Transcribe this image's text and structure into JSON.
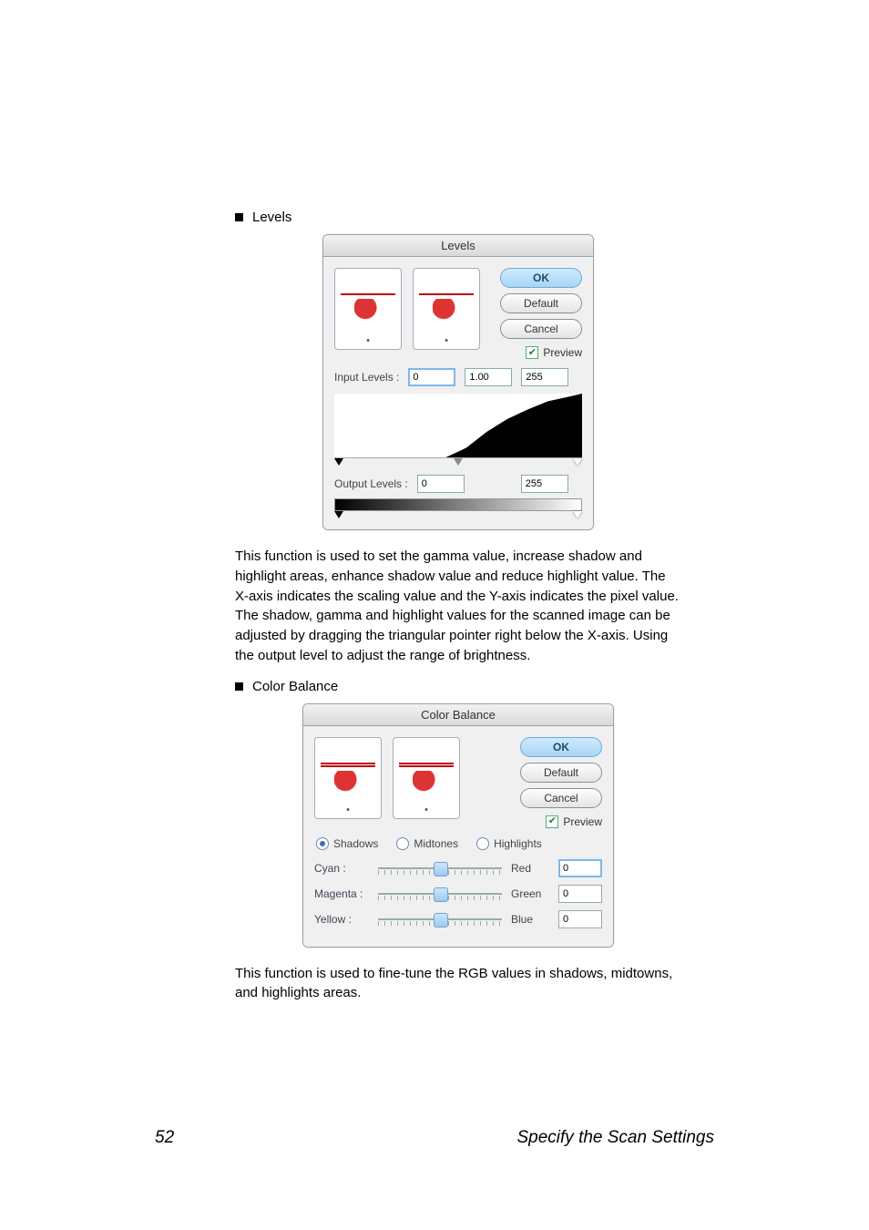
{
  "bullets": {
    "levels": "Levels",
    "color_balance": "Color Balance"
  },
  "levels_dialog": {
    "title": "Levels",
    "buttons": {
      "ok": "OK",
      "default": "Default",
      "cancel": "Cancel"
    },
    "preview": "Preview",
    "input_label": "Input Levels :",
    "input_vals": {
      "a": "0",
      "b": "1.00",
      "c": "255"
    },
    "output_label": "Output Levels :",
    "output_vals": {
      "a": "0",
      "b": "255"
    }
  },
  "levels_para": "This function is used to set the gamma value, increase shadow and highlight areas, enhance shadow value and reduce highlight value. The X-axis indicates the scaling value and the Y-axis indicates the pixel value. The shadow, gamma and highlight values for the scanned image can be adjusted by dragging the triangular pointer right below the X-axis. Using the output level to adjust the range of brightness.",
  "cb_dialog": {
    "title": "Color Balance",
    "buttons": {
      "ok": "OK",
      "default": "Default",
      "cancel": "Cancel"
    },
    "preview": "Preview",
    "radios": {
      "shadows": "Shadows",
      "midtones": "Midtones",
      "highlights": "Highlights"
    },
    "rows": {
      "cyan": {
        "left": "Cyan :",
        "right": "Red",
        "val": "0"
      },
      "magenta": {
        "left": "Magenta :",
        "right": "Green",
        "val": "0"
      },
      "yellow": {
        "left": "Yellow :",
        "right": "Blue",
        "val": "0"
      }
    }
  },
  "cb_para": "This function is used to fine-tune the RGB values in shadows, midtowns, and highlights areas.",
  "footer": {
    "page": "52",
    "section": "Specify the Scan Settings"
  }
}
